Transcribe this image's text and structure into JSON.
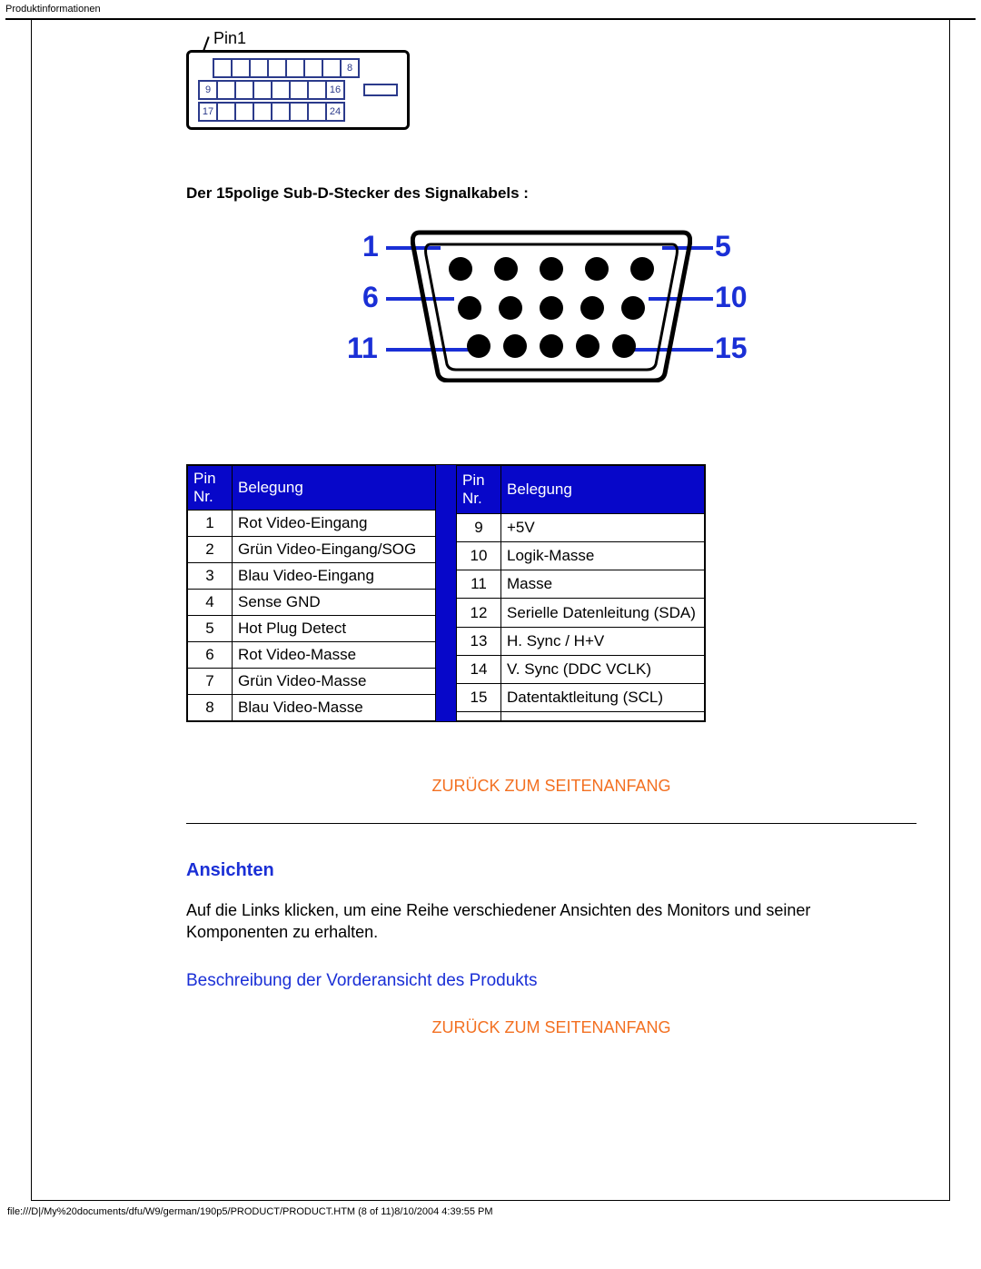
{
  "header": "Produktinformationen",
  "dvi": {
    "pin1_label": "Pin1",
    "numbers": [
      "8",
      "9",
      "16",
      "17",
      "24"
    ]
  },
  "section_heading": "Der 15polige Sub-D-Stecker des Signalkabels :",
  "vga_labels": {
    "l1": "1",
    "l2": "6",
    "l3": "11",
    "r1": "5",
    "r2": "10",
    "r3": "15"
  },
  "table": {
    "col_pin": "Pin Nr.",
    "col_assign": "Belegung",
    "left": [
      {
        "n": "1",
        "a": "Rot Video-Eingang"
      },
      {
        "n": "2",
        "a": "Grün Video-Eingang/SOG"
      },
      {
        "n": "3",
        "a": "Blau Video-Eingang"
      },
      {
        "n": "4",
        "a": "Sense GND"
      },
      {
        "n": "5",
        "a": "Hot Plug Detect"
      },
      {
        "n": "6",
        "a": "Rot Video-Masse"
      },
      {
        "n": "7",
        "a": "Grün Video-Masse"
      },
      {
        "n": "8",
        "a": "Blau Video-Masse"
      }
    ],
    "right": [
      {
        "n": "9",
        "a": "+5V"
      },
      {
        "n": "10",
        "a": "Logik-Masse"
      },
      {
        "n": "11",
        "a": "Masse"
      },
      {
        "n": "12",
        "a": "Serielle Datenleitung (SDA)"
      },
      {
        "n": "13",
        "a": "H. Sync / H+V"
      },
      {
        "n": "14",
        "a": "V. Sync (DDC VCLK)"
      },
      {
        "n": "15",
        "a": "Datentaktleitung (SCL)"
      }
    ]
  },
  "back_to_top": "ZURÜCK ZUM SEITENANFANG",
  "views": {
    "heading": "Ansichten",
    "body": "Auf die Links klicken, um eine Reihe verschiedener Ansichten des Monitors und seiner Komponenten zu erhalten.",
    "link": "Beschreibung der Vorderansicht des Produkts"
  },
  "footer": "file:///D|/My%20documents/dfu/W9/german/190p5/PRODUCT/PRODUCT.HTM (8 of 11)8/10/2004 4:39:55 PM"
}
